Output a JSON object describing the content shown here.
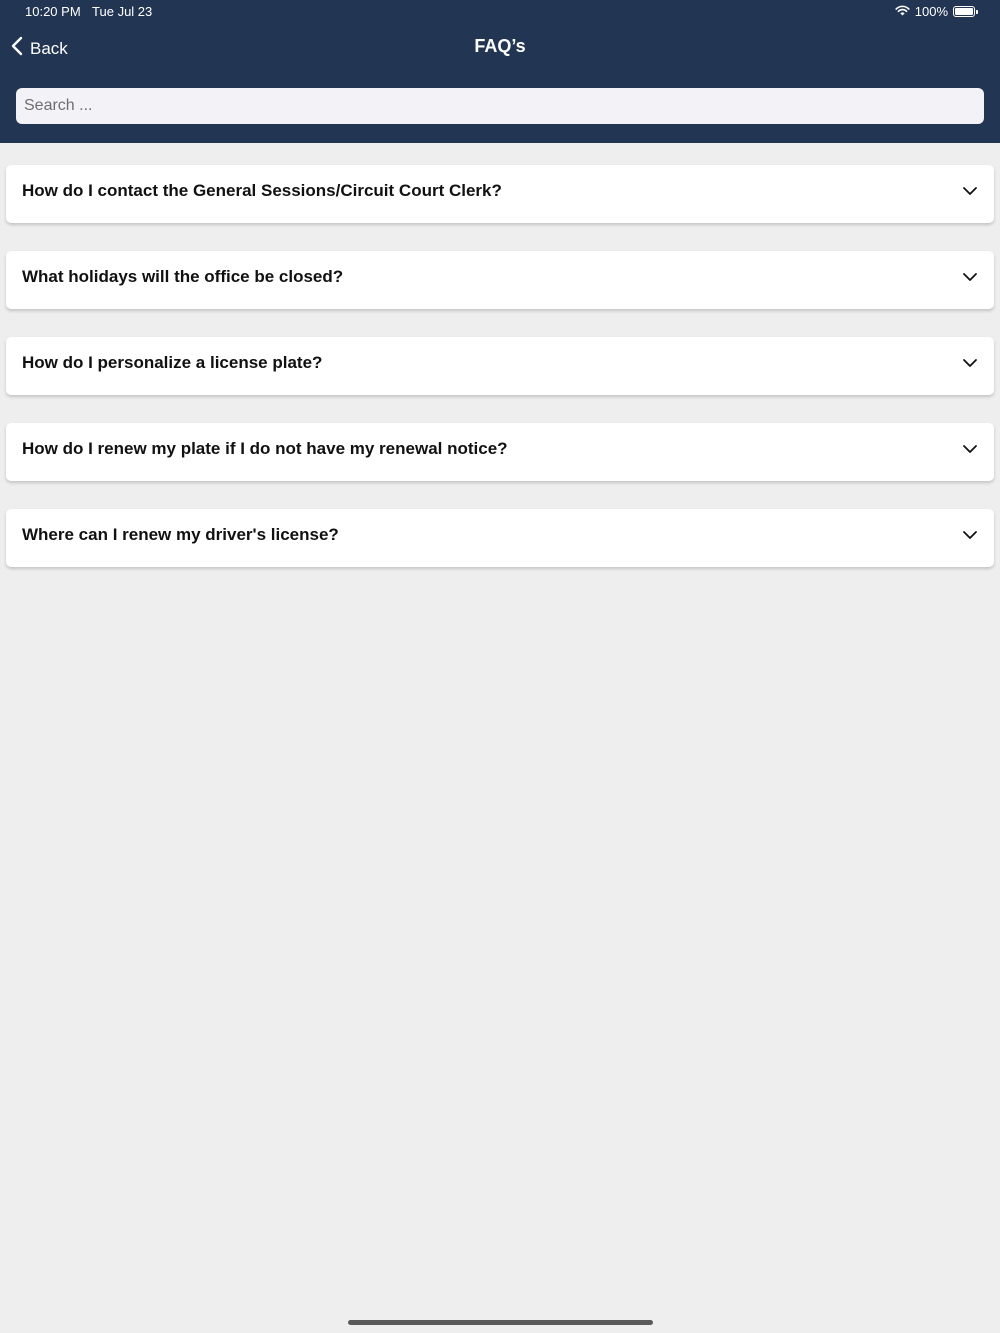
{
  "status_bar": {
    "time": "10:20 PM",
    "date": "Tue Jul 23",
    "battery": "100%",
    "icons": [
      "wifi-icon",
      "battery-icon"
    ]
  },
  "nav": {
    "back_label": "Back",
    "title": "FAQ’s",
    "back_icon": "chevron-left-icon"
  },
  "search": {
    "placeholder": "Search ...",
    "value": ""
  },
  "faqs": [
    {
      "question": "How do I contact the General Sessions/Circuit Court Clerk?"
    },
    {
      "question": "What holidays will the office be closed?"
    },
    {
      "question": "How do I personalize a license plate?"
    },
    {
      "question": "How do I renew my plate if I do not have my renewal notice?"
    },
    {
      "question": "Where can I renew my driver's license?"
    }
  ],
  "colors": {
    "header_bg": "#223653",
    "page_bg": "#eeeeee",
    "card_bg": "#ffffff"
  }
}
